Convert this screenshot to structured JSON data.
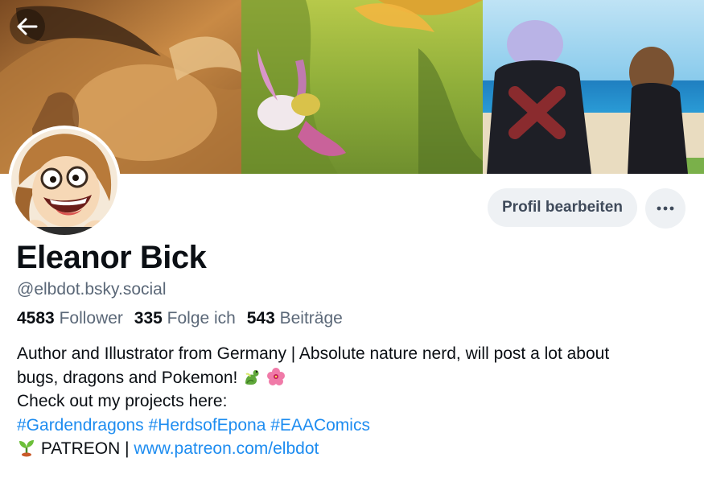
{
  "profile": {
    "display_name": "Eleanor Bick",
    "handle": "@elbdot.bsky.social",
    "edit_button_label": "Profil bearbeiten",
    "more_button_label": "⋯"
  },
  "stats": {
    "followers_count": "4583",
    "followers_label": "Follower",
    "following_count": "335",
    "following_label": "Folge ich",
    "posts_count": "543",
    "posts_label": "Beiträge"
  },
  "bio": {
    "line1": "Author and Illustrator from Germany | Absolute nature nerd, will post a lot about",
    "line2": "bugs, dragons and Pokemon!",
    "line2_emojis": [
      "dragon-emoji",
      "hibiscus-emoji"
    ],
    "line3": "Check out my projects here:",
    "hashtags": [
      "#Gardendragons",
      "#HerdsofEpona",
      "#EAAComics"
    ],
    "patreon_label": "PATREON |",
    "patreon_link": "www.patreon.com/elbdot",
    "patreon_emoji": "seedling-emoji"
  },
  "icons": {
    "back": "arrow-left-icon",
    "more": "ellipsis-icon"
  },
  "colors": {
    "accent": "#1d8cf0",
    "muted_text": "#5b6878",
    "button_bg": "#eef1f4",
    "text": "#0b0f14"
  }
}
